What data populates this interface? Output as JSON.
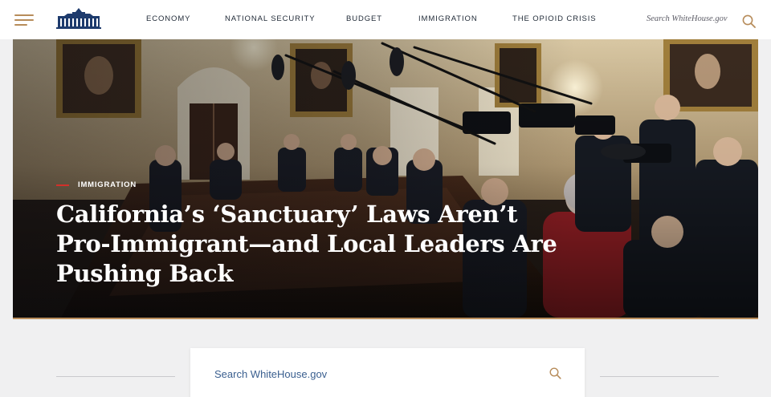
{
  "header": {
    "menu_icon": "hamburger-menu-icon",
    "logo_icon": "white-house-logo-icon",
    "nav": [
      {
        "label": "ECONOMY"
      },
      {
        "label": "NATIONAL SECURITY"
      },
      {
        "label": "BUDGET"
      },
      {
        "label": "IMMIGRATION"
      },
      {
        "label": "THE OPIOID CRISIS"
      }
    ],
    "search_placeholder": "Search WhiteHouse.gov",
    "search_icon": "search-icon"
  },
  "hero": {
    "category": "IMMIGRATION",
    "headline": "California’s ‘Sanctuary’ Laws Aren’t Pro-Immigrant—and Local Leaders Are Pushing Back",
    "image_icon": "cabinet-room-photo"
  },
  "search_section": {
    "placeholder": "Search WhiteHouse.gov",
    "search_icon": "search-icon"
  },
  "colors": {
    "accent_gold": "#b78c5a",
    "accent_red": "#d2302a",
    "navy": "#1f2936",
    "search_text": "#3a5f8f"
  }
}
